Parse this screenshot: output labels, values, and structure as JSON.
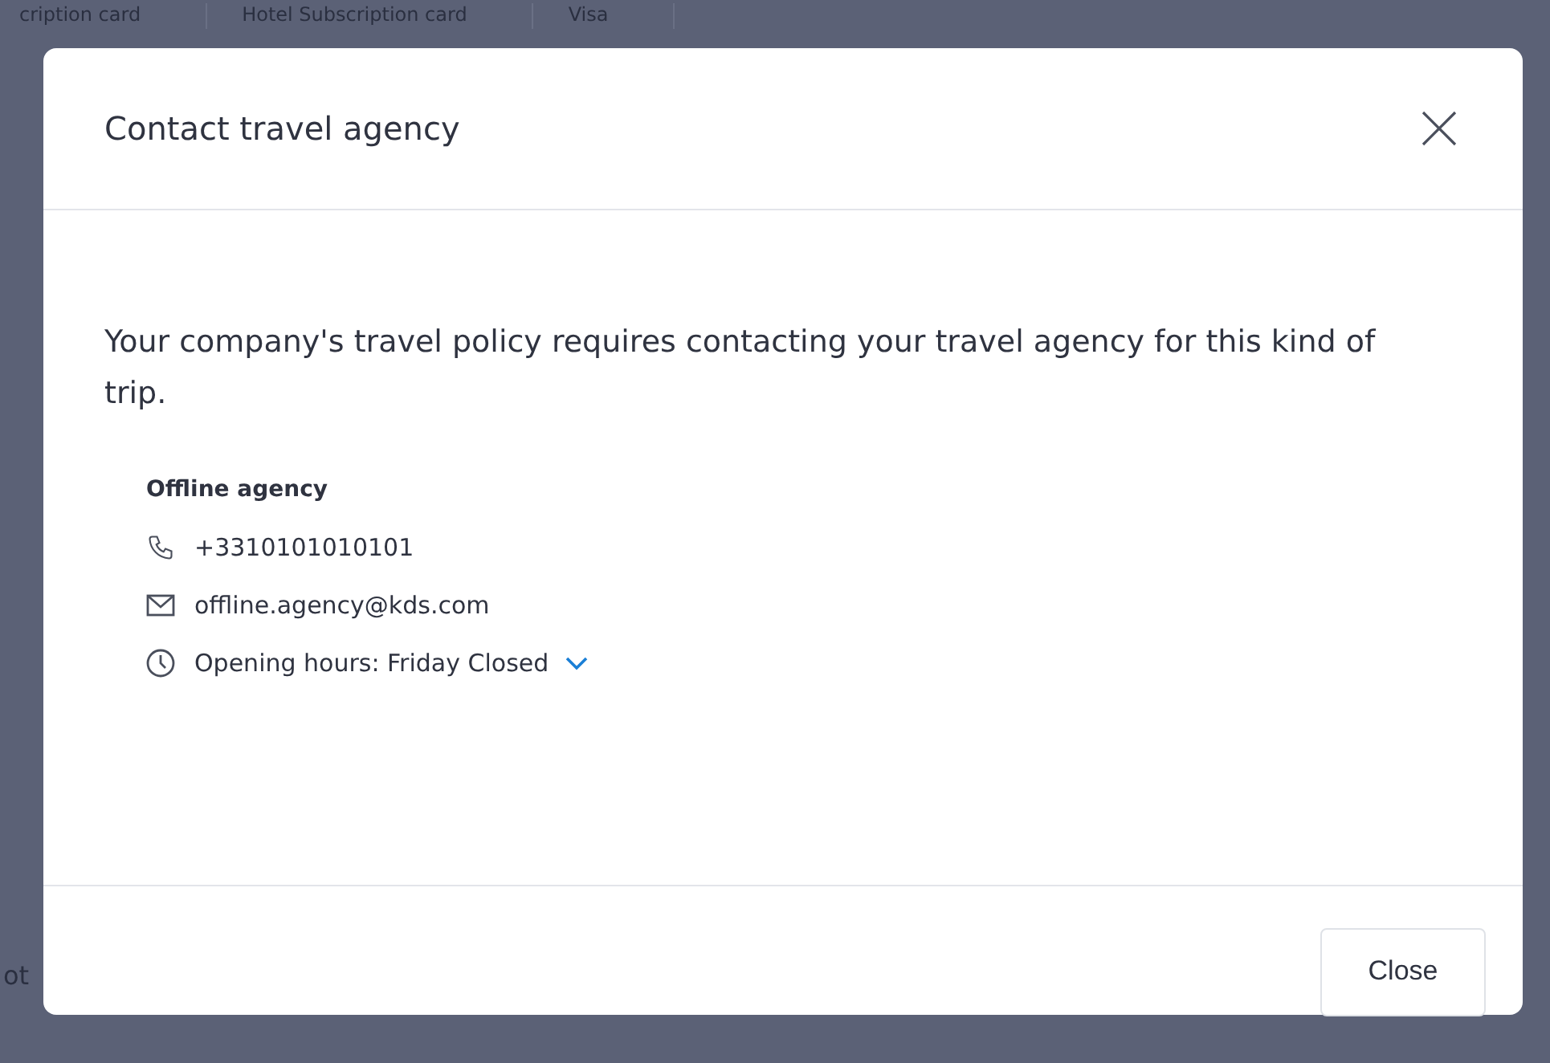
{
  "background": {
    "cells": [
      "cription card",
      "Hotel Subscription card",
      "Visa"
    ],
    "side_text": "ot"
  },
  "dialog": {
    "title": "Contact travel agency",
    "message": "Your company's travel policy requires contacting your travel agency for this kind of trip.",
    "agency": {
      "name": "Offline agency",
      "phone": "+3310101010101",
      "email": "offline.agency@kds.com",
      "hours": "Opening hours: Friday Closed",
      "hours_expanded": false
    },
    "buttons": [
      "Close"
    ]
  }
}
